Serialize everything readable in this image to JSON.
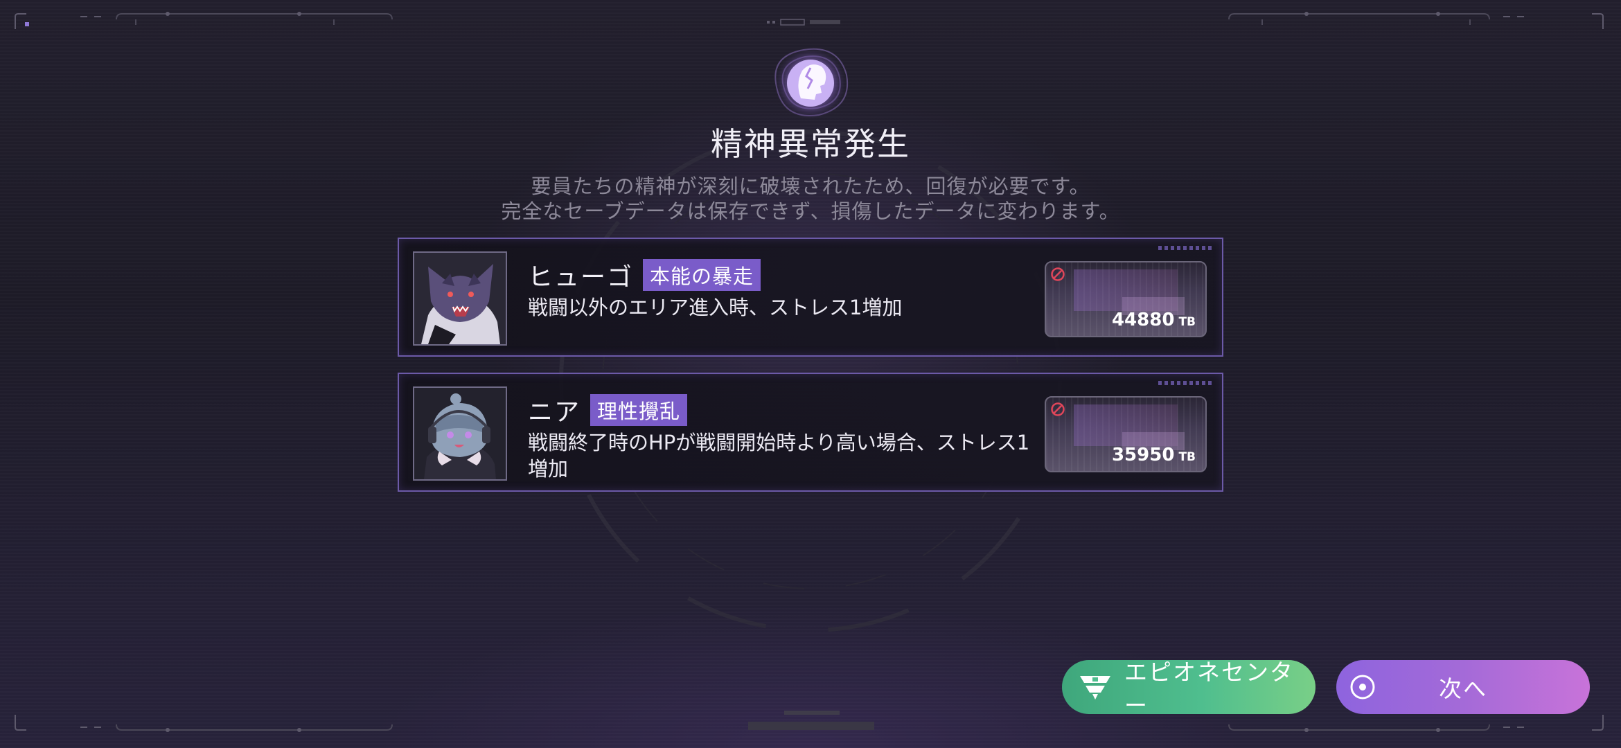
{
  "header": {
    "icon": "cracked-head-icon",
    "title": "精神異常発生",
    "description_line1": "要員たちの精神が深刻に破壊されたため、回復が必要です。",
    "description_line2": "完全なセーブデータは保存できず、損傷したデータに変わります。"
  },
  "cards": [
    {
      "name": "ヒューゴ",
      "tag": "本能の暴走",
      "effect": "戦闘以外のエリア進入時、ストレス1増加",
      "data_size": "44880",
      "data_unit": "TB"
    },
    {
      "name": "ニア",
      "tag": "理性攪乱",
      "effect": "戦闘終了時のHPが戦闘開始時より高い場合、ストレス1増加",
      "data_size": "35950",
      "data_unit": "TB"
    }
  ],
  "buttons": {
    "epio_center": "エピオネセンター",
    "next": "次へ"
  },
  "colors": {
    "accent_purple": "#7a5cc9",
    "button_green": "#4fbe8e",
    "button_purple": "#a46ad8",
    "ban_red": "#e0465a"
  }
}
